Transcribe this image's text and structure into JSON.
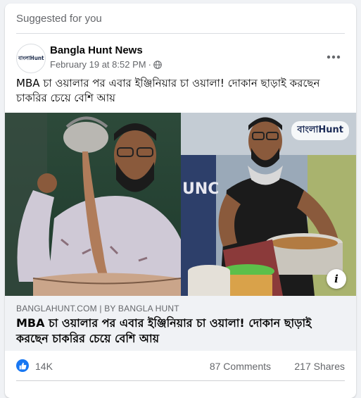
{
  "header": {
    "suggested_label": "Suggested for you"
  },
  "post": {
    "page_name": "Bangla Hunt News",
    "avatar_logo_text": "বাংলাHunt",
    "timestamp": "February 19 at 8:52 PM",
    "separator": "·",
    "privacy_icon": "globe-icon",
    "more_icon": "more-horizontal-icon",
    "caption": "MBA চা ওয়ালার পর এবার ইঞ্জিনিয়ার চা ওয়ালা! দোকান ছাড়াই করছেন চাকরির চেয়ে বেশি আয়"
  },
  "media": {
    "watermark": "বাংলাHunt",
    "info_icon_label": "i"
  },
  "link": {
    "domain": "BANGLAHUNT.COM | BY BANGLA HUNT",
    "title": "MBA চা ওয়ালার পর এবার ইঞ্জিনিয়ার চা ওয়ালা! দোকান ছাড়াই করছেন চাকরির চেয়ে বেশি আয়"
  },
  "stats": {
    "reactions": "14K",
    "comments": "87 Comments",
    "shares": "217 Shares"
  },
  "colors": {
    "accent": "#1877f2",
    "secondary_text": "#65676b",
    "background": "#f0f2f5"
  }
}
